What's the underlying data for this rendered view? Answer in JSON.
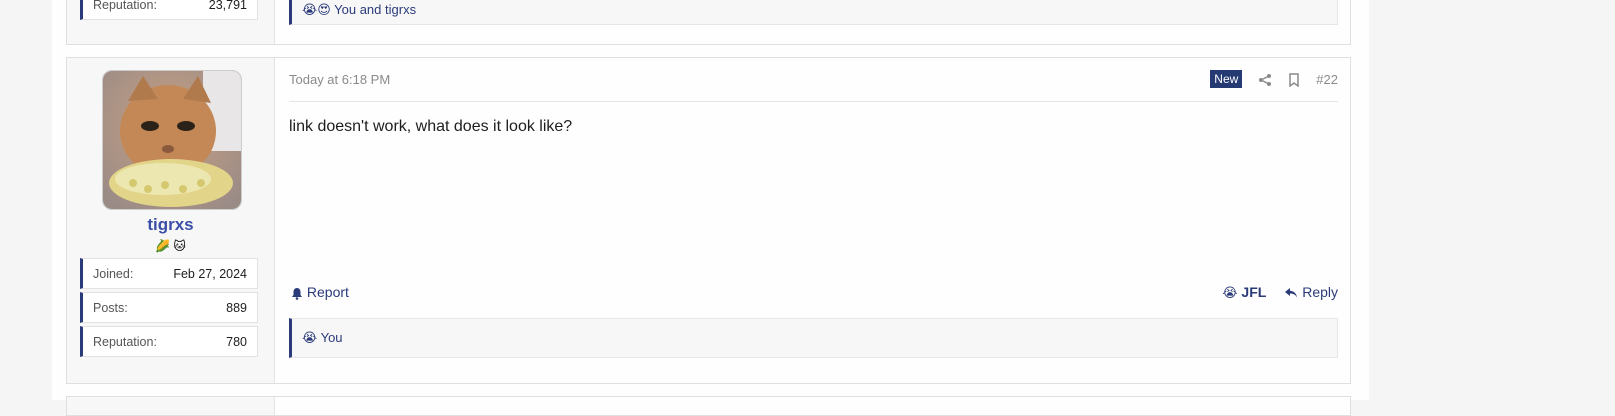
{
  "previous_post": {
    "reputation_label": "Reputation:",
    "reputation_value": "23,791",
    "reactions_text": "You and tigrxs",
    "reaction_icons": [
      "😭",
      "😍"
    ]
  },
  "post": {
    "date": "Today at 6:18 PM",
    "badge": "New",
    "number": "#22",
    "author": {
      "username": "tigrxs",
      "flair": "🌽 🐱",
      "stats": [
        {
          "label": "Joined:",
          "value": "Feb 27, 2024"
        },
        {
          "label": "Posts:",
          "value": "889"
        },
        {
          "label": "Reputation:",
          "value": "780"
        }
      ]
    },
    "message": "link doesn't work, what does it look like?",
    "actions": {
      "report": "Report",
      "jfl": "JFL",
      "reply": "Reply"
    },
    "reactions_text": "You",
    "reaction_icon": "😭"
  },
  "colors": {
    "accent": "#2b3b7a",
    "username": "#3a4fa8",
    "badge_bg": "#253a73"
  }
}
